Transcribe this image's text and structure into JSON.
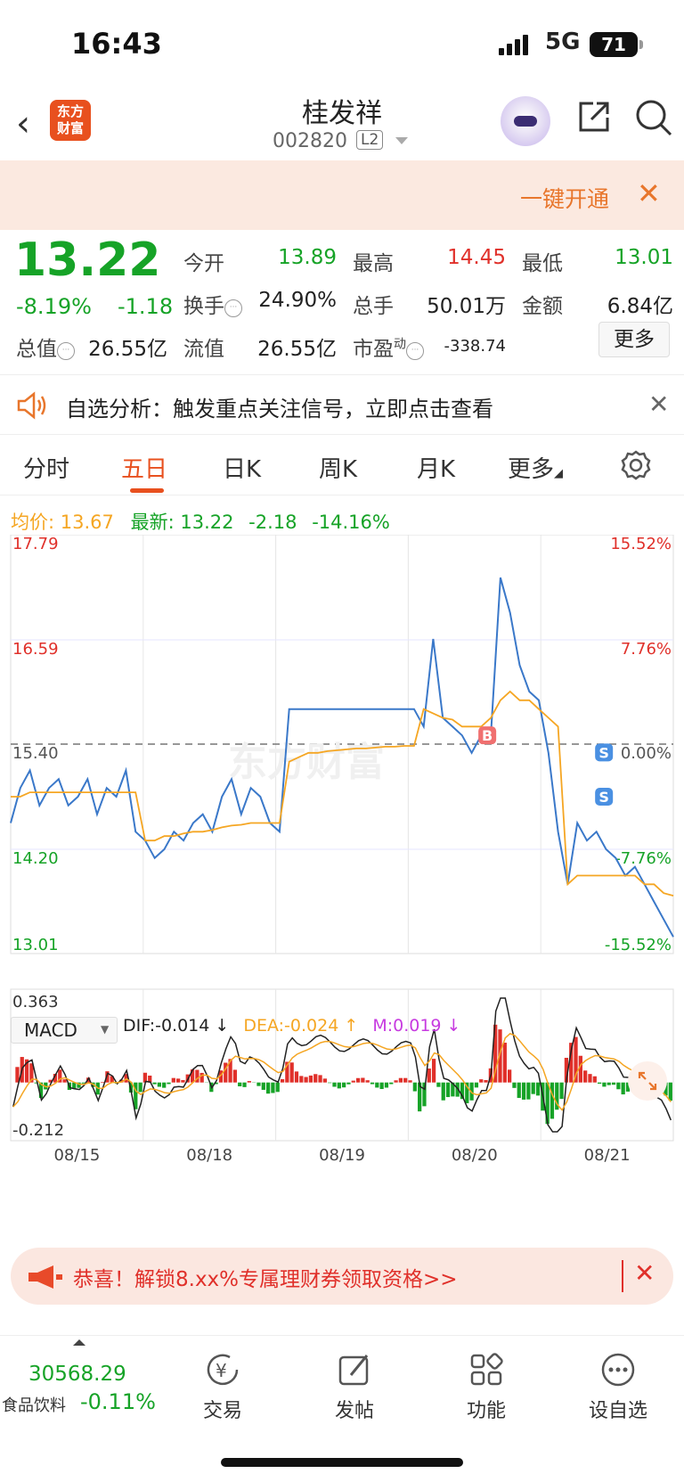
{
  "status": {
    "time": "16:43",
    "network": "5G",
    "battery": "71"
  },
  "header": {
    "logo_text": "东方\n财富",
    "stock_name": "桂发祥",
    "stock_code": "002820",
    "level": "L2"
  },
  "banner": {
    "text": "一键开通"
  },
  "quote": {
    "price": "13.22",
    "change_pct": "-8.19%",
    "change": "-1.18",
    "open_label": "今开",
    "open": "13.89",
    "high_label": "最高",
    "high": "14.45",
    "low_label": "最低",
    "low": "13.01",
    "turnover_label": "换手",
    "turnover": "24.90%",
    "volume_label": "总手",
    "volume": "50.01万",
    "amount_label": "金额",
    "amount": "6.84亿",
    "mktcap_label": "总值",
    "mktcap": "26.55亿",
    "float_label": "流值",
    "float": "26.55亿",
    "pe_label": "市盈",
    "pe_sup": "动",
    "pe": "-338.74",
    "more": "更多"
  },
  "notice": {
    "text": "自选分析：触发重点关注信号，立即点击查看"
  },
  "tabs": [
    "分时",
    "五日",
    "日K",
    "周K",
    "月K",
    "更多"
  ],
  "active_tab": "五日",
  "summary": {
    "avg_label": "均价:",
    "avg": "13.67",
    "last_label": "最新:",
    "last": "13.22",
    "chg": "-2.18",
    "chg_pct": "-14.16%"
  },
  "chart_data": {
    "type": "line",
    "price_ticks": [
      "17.79",
      "16.59",
      "15.40",
      "14.20",
      "13.01"
    ],
    "pct_ticks": [
      "15.52%",
      "7.76%",
      "0.00%",
      "-7.76%",
      "-15.52%"
    ],
    "dates": [
      "08/15",
      "08/18",
      "08/19",
      "08/20",
      "08/21"
    ],
    "ylim": [
      13.01,
      17.79
    ],
    "prev_close": 15.4,
    "series": [
      {
        "color": "#3a78c9",
        "values": [
          14.5,
          14.9,
          15.1,
          14.7,
          14.9,
          15.0,
          14.7,
          14.8,
          15.0,
          14.6,
          14.9,
          14.8,
          15.1,
          14.4,
          14.3,
          14.1,
          14.2,
          14.4,
          14.3,
          14.5,
          14.6,
          14.4,
          14.8,
          15.0,
          14.6,
          14.9,
          14.8,
          14.5,
          14.4,
          15.8,
          15.8,
          15.8,
          15.8,
          15.8,
          15.8,
          15.8,
          15.8,
          15.8,
          15.8,
          15.8,
          15.8,
          15.8,
          15.8,
          15.6,
          16.6,
          15.7,
          15.6,
          15.5,
          15.3,
          15.5,
          15.5,
          17.3,
          16.9,
          16.3,
          16.0,
          15.9,
          15.3,
          14.4,
          13.8,
          14.5,
          14.3,
          14.4,
          14.2,
          14.1,
          13.9,
          14.0,
          13.8,
          13.6,
          13.4,
          13.2
        ]
      },
      {
        "color": "#f5a623",
        "values": [
          14.8,
          14.8,
          14.85,
          14.85,
          14.85,
          14.85,
          14.85,
          14.85,
          14.85,
          14.85,
          14.85,
          14.85,
          14.85,
          14.85,
          14.3,
          14.3,
          14.35,
          14.35,
          14.38,
          14.4,
          14.4,
          14.42,
          14.45,
          14.47,
          14.48,
          14.5,
          14.5,
          14.5,
          14.5,
          15.2,
          15.25,
          15.3,
          15.3,
          15.32,
          15.33,
          15.34,
          15.35,
          15.35,
          15.36,
          15.37,
          15.37,
          15.38,
          15.38,
          15.8,
          15.75,
          15.7,
          15.68,
          15.6,
          15.6,
          15.6,
          15.7,
          15.9,
          16.0,
          15.9,
          15.9,
          15.8,
          15.7,
          15.6,
          13.8,
          13.9,
          13.9,
          13.9,
          13.9,
          13.9,
          13.9,
          13.9,
          13.8,
          13.8,
          13.7,
          13.67
        ]
      }
    ],
    "markers": [
      "B",
      "S",
      "S"
    ]
  },
  "macd": {
    "label": "MACD",
    "dif": "DIF:-0.014 ↓",
    "dea": "DEA:-0.024 ↑",
    "m": "M:0.019 ↓",
    "top": "0.363",
    "bottom": "-0.212"
  },
  "promo": {
    "text": "恭喜！解锁8.xx%专属理财券领取资格>>"
  },
  "bottom_nav": {
    "index_value": "30568.29",
    "index_name": "食品饮料",
    "index_chg": "-0.11%",
    "items": [
      "交易",
      "发帖",
      "功能",
      "设自选"
    ]
  }
}
